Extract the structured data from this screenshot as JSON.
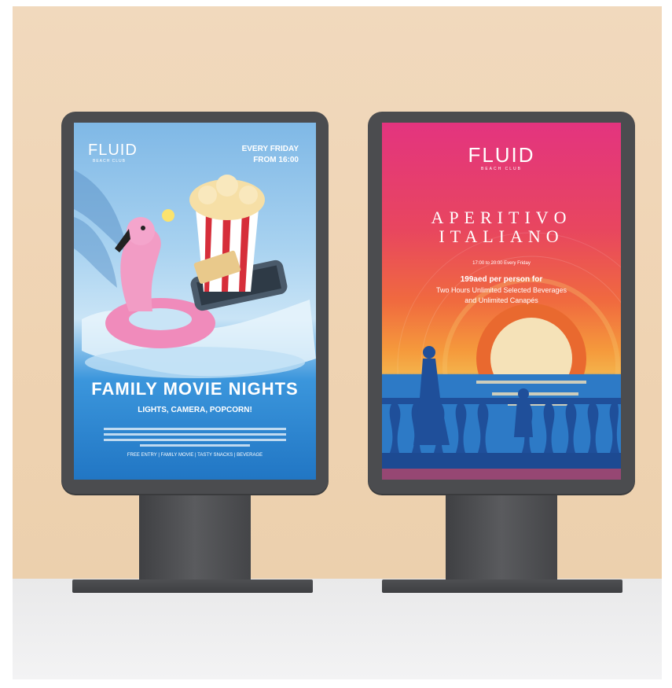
{
  "left_poster": {
    "logo": "FLUID",
    "logo_sub": "BEACH CLUB",
    "schedule_line1": "EVERY FRIDAY",
    "schedule_line2": "FROM 16:00",
    "title": "FAMILY MOVIE NIGHTS",
    "subtitle": "LIGHTS, CAMERA, POPCORN!",
    "footer": "FREE ENTRY  |  FAMILY MOVIE  |  TASTY SNACKS  |  BEVERAGE",
    "colors": {
      "sky": "#8fc3ea",
      "water": "#2f8fd6",
      "flamingo": "#f08bbb"
    }
  },
  "right_poster": {
    "logo": "FLUID",
    "logo_sub": "BEACH CLUB",
    "title_line1": "APERITIVO",
    "title_line2": "ITALIANO",
    "time_line": "17:00 to 20:00 Every Friday",
    "price_line": "199aed per person for",
    "offer_line1": "Two Hours Unlimited Selected Beverages",
    "offer_line2": "and Unlimited Canapés",
    "colors": {
      "top": "#e8377c",
      "middle": "#f0743b",
      "sea": "#2d7ac6",
      "sun": "#f5e2b8"
    }
  }
}
